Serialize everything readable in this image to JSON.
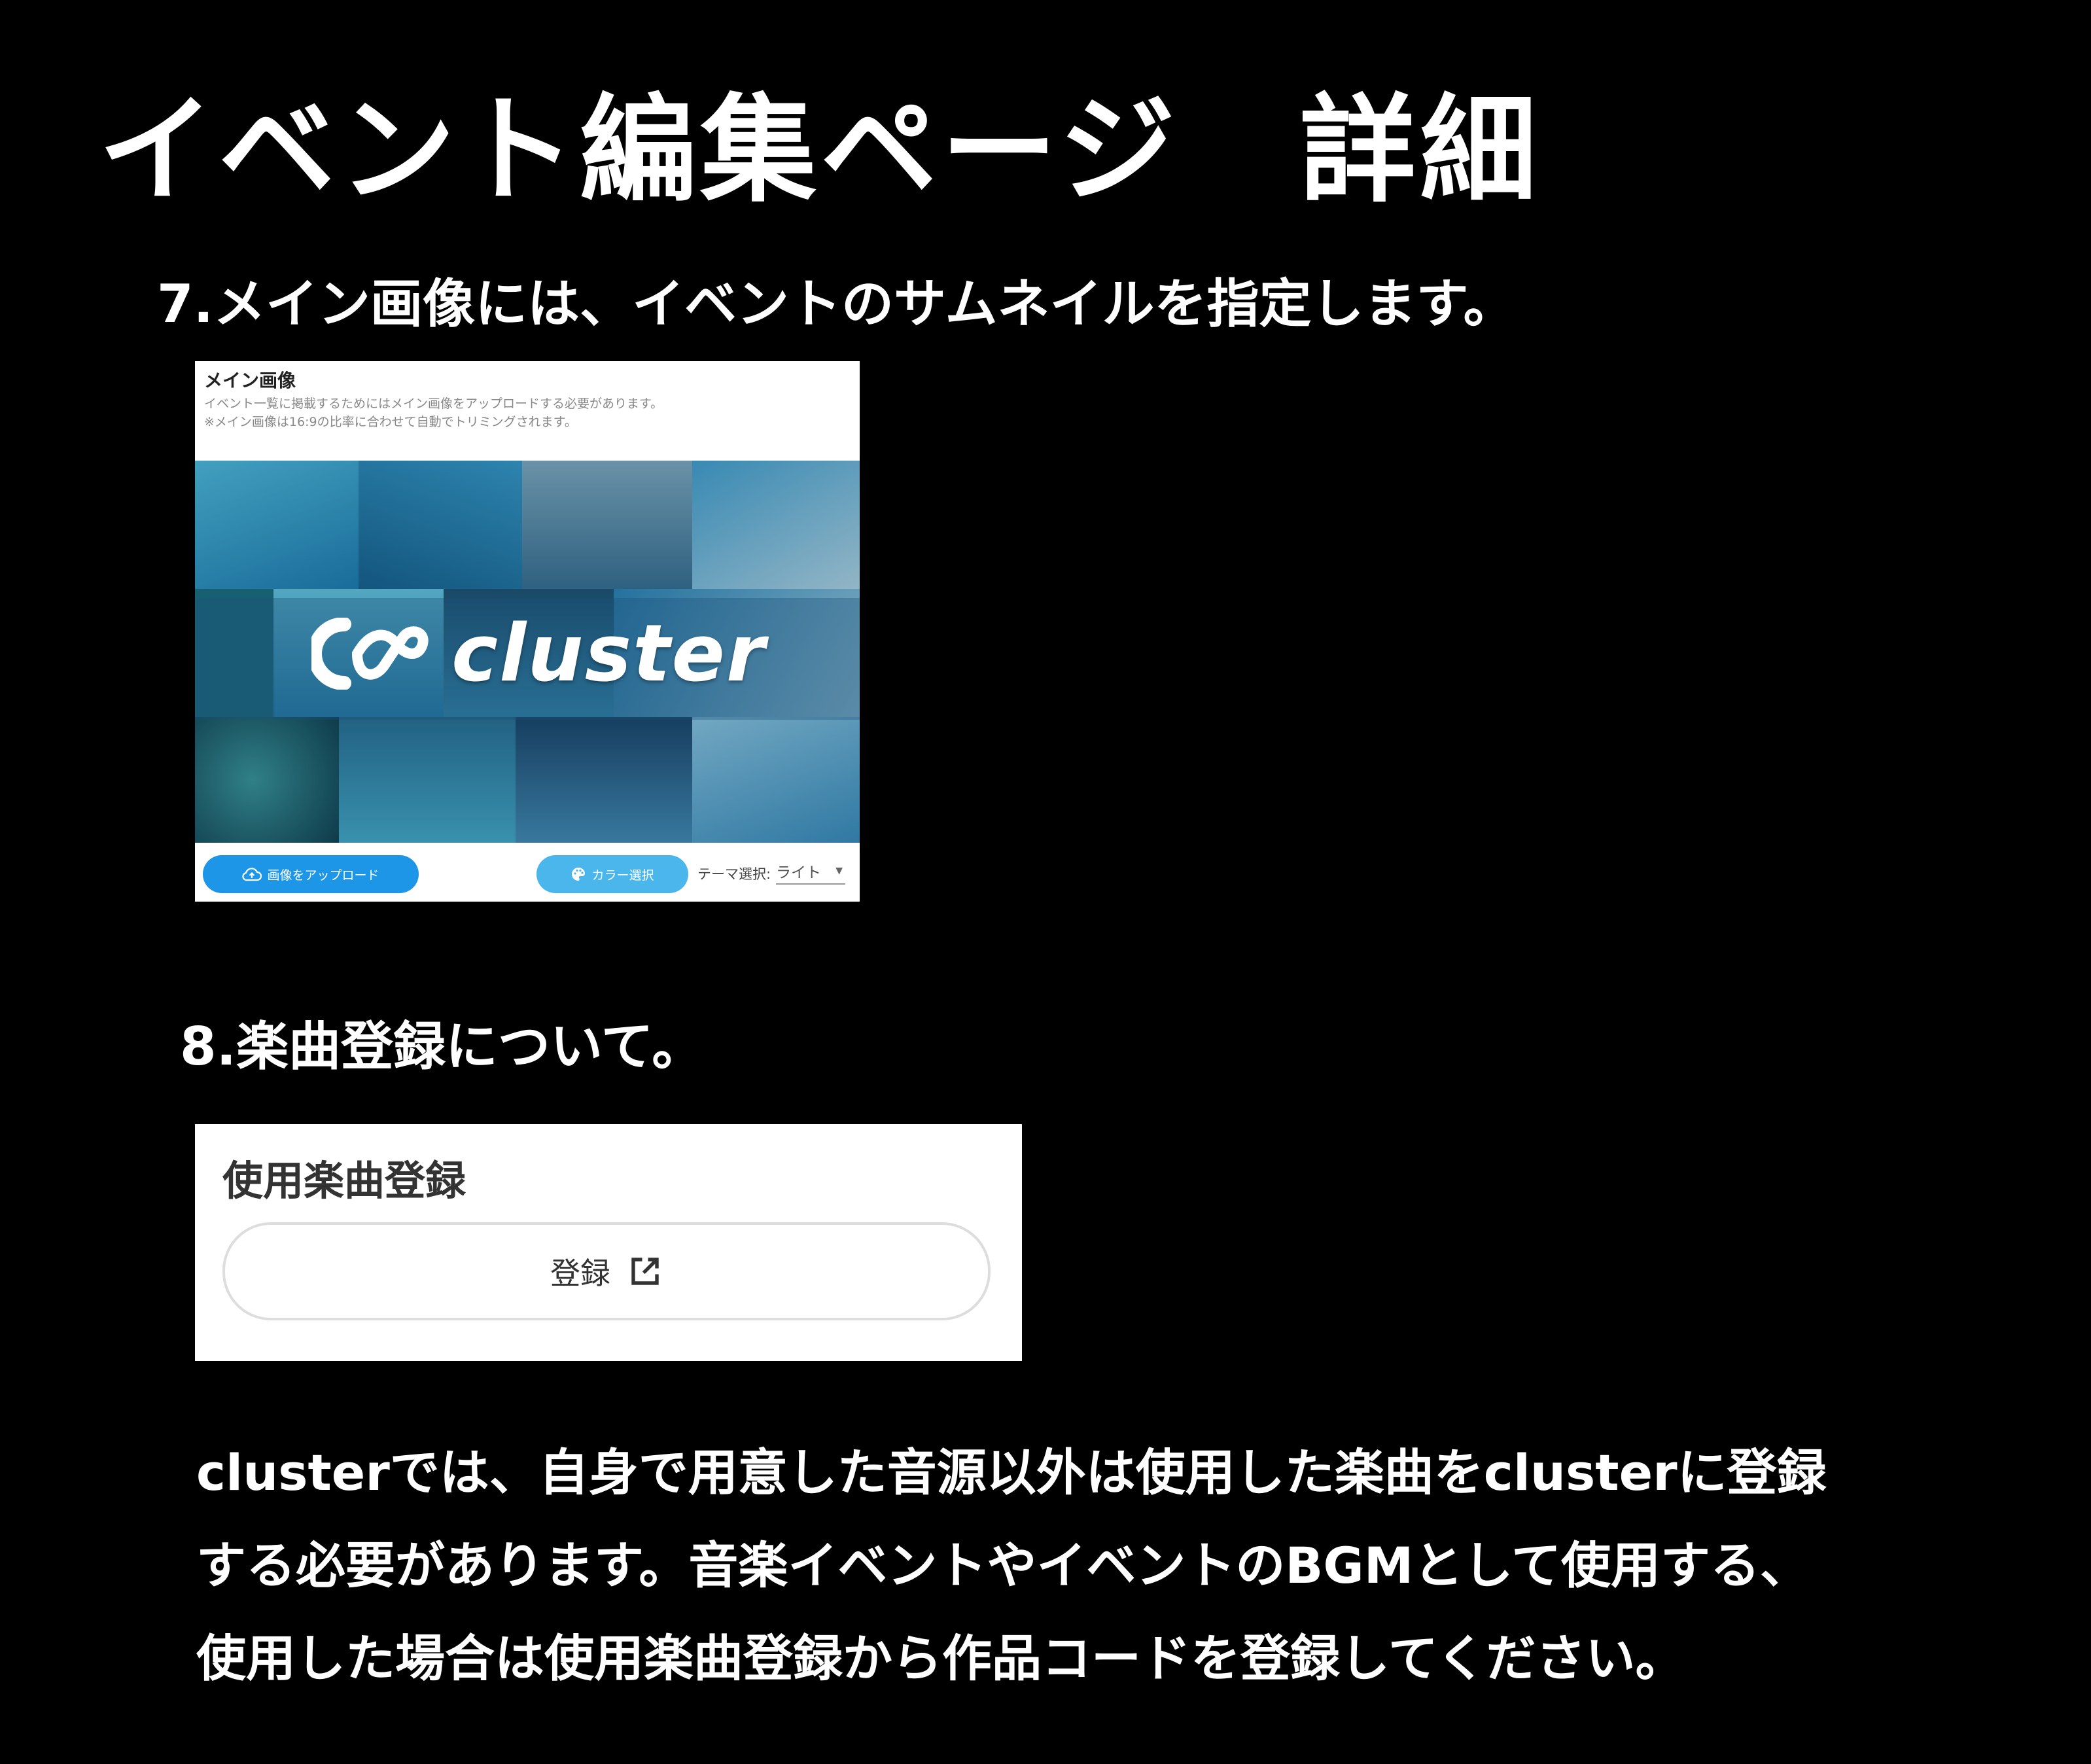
{
  "heading": "イベント編集ページ　詳細",
  "steps": {
    "main_image": "7.メイン画像には、イベントのサムネイルを指定します。",
    "music": "8.楽曲登録について。"
  },
  "main_image_panel": {
    "label": "メイン画像",
    "desc_line1": "イベント一覧に掲載するためにはメイン画像をアップロードする必要があります。",
    "desc_line2": "※メイン画像は16:9の比率に合わせて自動でトリミングされます。",
    "thumbnail_logo_text": "cluster",
    "upload_button": "画像をアップロード",
    "color_button": "カラー選択",
    "theme_label": "テーマ選択:",
    "theme_value": "ライト",
    "accent_color": "#1e96e8"
  },
  "music_panel": {
    "title": "使用楽曲登録",
    "register_button": "登録"
  },
  "paragraph": {
    "line1": "clusterでは、自身で用意した音源以外は使用した楽曲をclusterに登録",
    "line2": "する必要があります。音楽イベントやイベントのBGMとして使用する、",
    "line3": "使用した場合は使用楽曲登録から作品コードを登録してください。"
  }
}
